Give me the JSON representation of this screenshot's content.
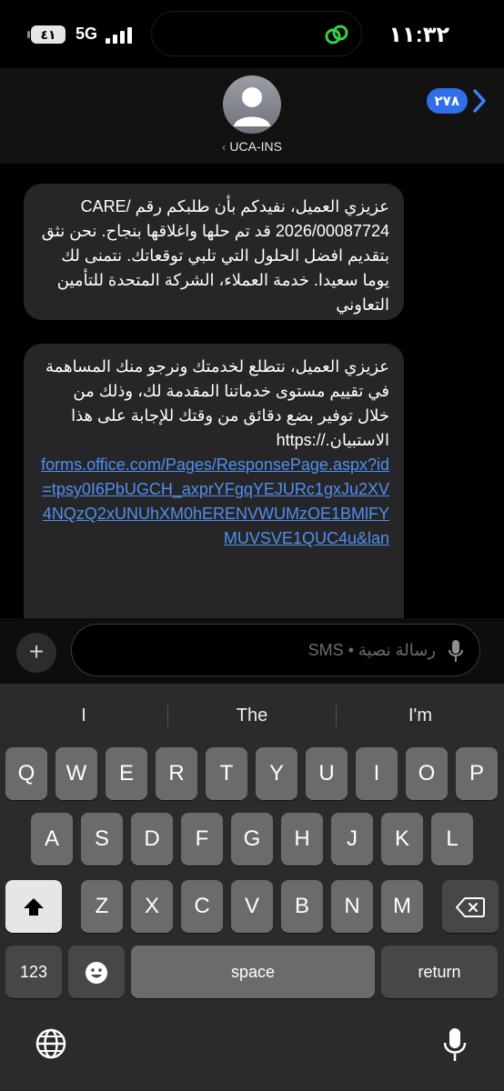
{
  "status": {
    "time": "١١:٣٢",
    "network": "5G",
    "battery": "٤١"
  },
  "header": {
    "back_badge": "٢٧٨",
    "contact_name": "UCA-INS"
  },
  "messages": [
    {
      "text": "عزيزي العميل، نفيدكم بأن طلبكم رقم CARE/ 2026/00087724 قد تم حلها واغلاقها بنجاح. نحن نثق بتقديم افضل الحلول التي تلبي توقعاتك. نتمنى لك يوما سعيدا. خدمة العملاء، الشركة المتحدة للتأمين التعاوني"
    },
    {
      "text": "عزيزي العميل، نتطلع لخدمتك ونرجو منك المساهمة في تقييم مستوى خدماتنا المقدمة لك، وذلك من خلال توفير بضع دقائق من وقتك للإجابة على هذا الاستبيان.//:https",
      "link": "forms.office.com/Pages/ResponsePage.aspx?id=tpsy0I6PbUGCH_axprYFgqYEJURc1gxJu2XV4NQzQ2xUNUhXM0hERENVWUMzOE1BMlFYMUVSVE1QUC4u&lan"
    }
  ],
  "compose": {
    "placeholder": "رسالة نصية • SMS"
  },
  "keyboard": {
    "suggestions": [
      "I",
      "The",
      "I'm"
    ],
    "row1": [
      "Q",
      "W",
      "E",
      "R",
      "T",
      "Y",
      "U",
      "I",
      "O",
      "P"
    ],
    "row2": [
      "A",
      "S",
      "D",
      "F",
      "G",
      "H",
      "J",
      "K",
      "L"
    ],
    "row3": [
      "Z",
      "X",
      "C",
      "V",
      "B",
      "N",
      "M"
    ],
    "numbers_label": "123",
    "space_label": "space",
    "return_label": "return"
  },
  "icons": [
    "battery-icon",
    "signal-icon",
    "link-icon",
    "chevron-right-icon",
    "avatar-icon",
    "plus-icon",
    "mic-icon",
    "shift-icon",
    "delete-icon",
    "emoji-icon",
    "globe-icon",
    "dictation-icon"
  ]
}
